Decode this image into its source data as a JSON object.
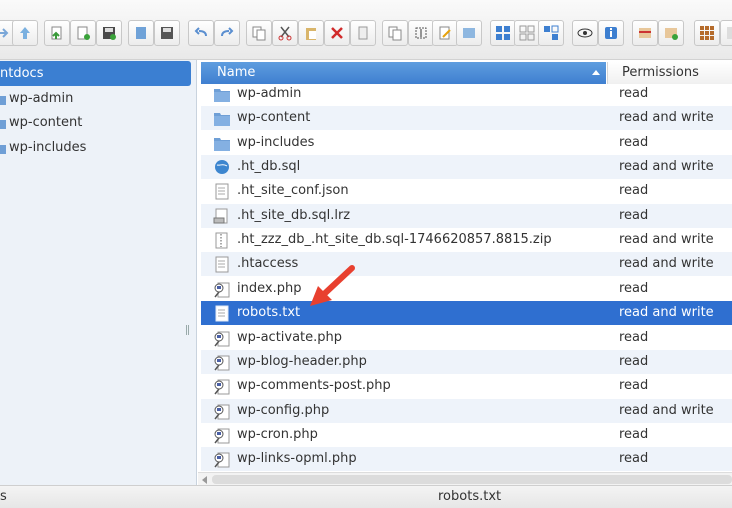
{
  "tree": {
    "selected": "ntdocs",
    "items": [
      "wp-admin",
      "wp-content",
      "wp-includes"
    ]
  },
  "list": {
    "header": {
      "name": "Name",
      "permissions": "Permissions"
    },
    "rows": [
      {
        "name": "wp-admin",
        "perm": "read",
        "icon": "folder-icon"
      },
      {
        "name": "wp-content",
        "perm": "read and write",
        "icon": "folder-icon"
      },
      {
        "name": "wp-includes",
        "perm": "read",
        "icon": "folder-icon"
      },
      {
        "name": ".ht_db.sql",
        "perm": "read and write",
        "icon": "globe-file-icon"
      },
      {
        "name": ".ht_site_conf.json",
        "perm": "read",
        "icon": "document-icon"
      },
      {
        "name": ".ht_site_db.sql.lrz",
        "perm": "read",
        "icon": "drive-file-icon"
      },
      {
        "name": ".ht_zzz_db_.ht_site_db.sql-1746620857.8815.zip",
        "perm": "read and write",
        "icon": "zip-file-icon"
      },
      {
        "name": ".htaccess",
        "perm": "read and write",
        "icon": "document-icon"
      },
      {
        "name": "index.php",
        "perm": "read",
        "icon": "php-file-icon"
      },
      {
        "name": "robots.txt",
        "perm": "read and write",
        "icon": "text-file-icon"
      },
      {
        "name": "wp-activate.php",
        "perm": "read",
        "icon": "php-file-icon"
      },
      {
        "name": "wp-blog-header.php",
        "perm": "read",
        "icon": "php-file-icon"
      },
      {
        "name": "wp-comments-post.php",
        "perm": "read",
        "icon": "php-file-icon"
      },
      {
        "name": "wp-config.php",
        "perm": "read and write",
        "icon": "php-file-icon"
      },
      {
        "name": "wp-cron.php",
        "perm": "read",
        "icon": "php-file-icon"
      },
      {
        "name": "wp-links-opml.php",
        "perm": "read",
        "icon": "php-file-icon"
      }
    ]
  },
  "status": {
    "left": "s",
    "center": "robots.txt"
  },
  "colors": {
    "selection": "#2f6fd0",
    "annotation": "#e8402f",
    "header": "#4a8ad6"
  }
}
